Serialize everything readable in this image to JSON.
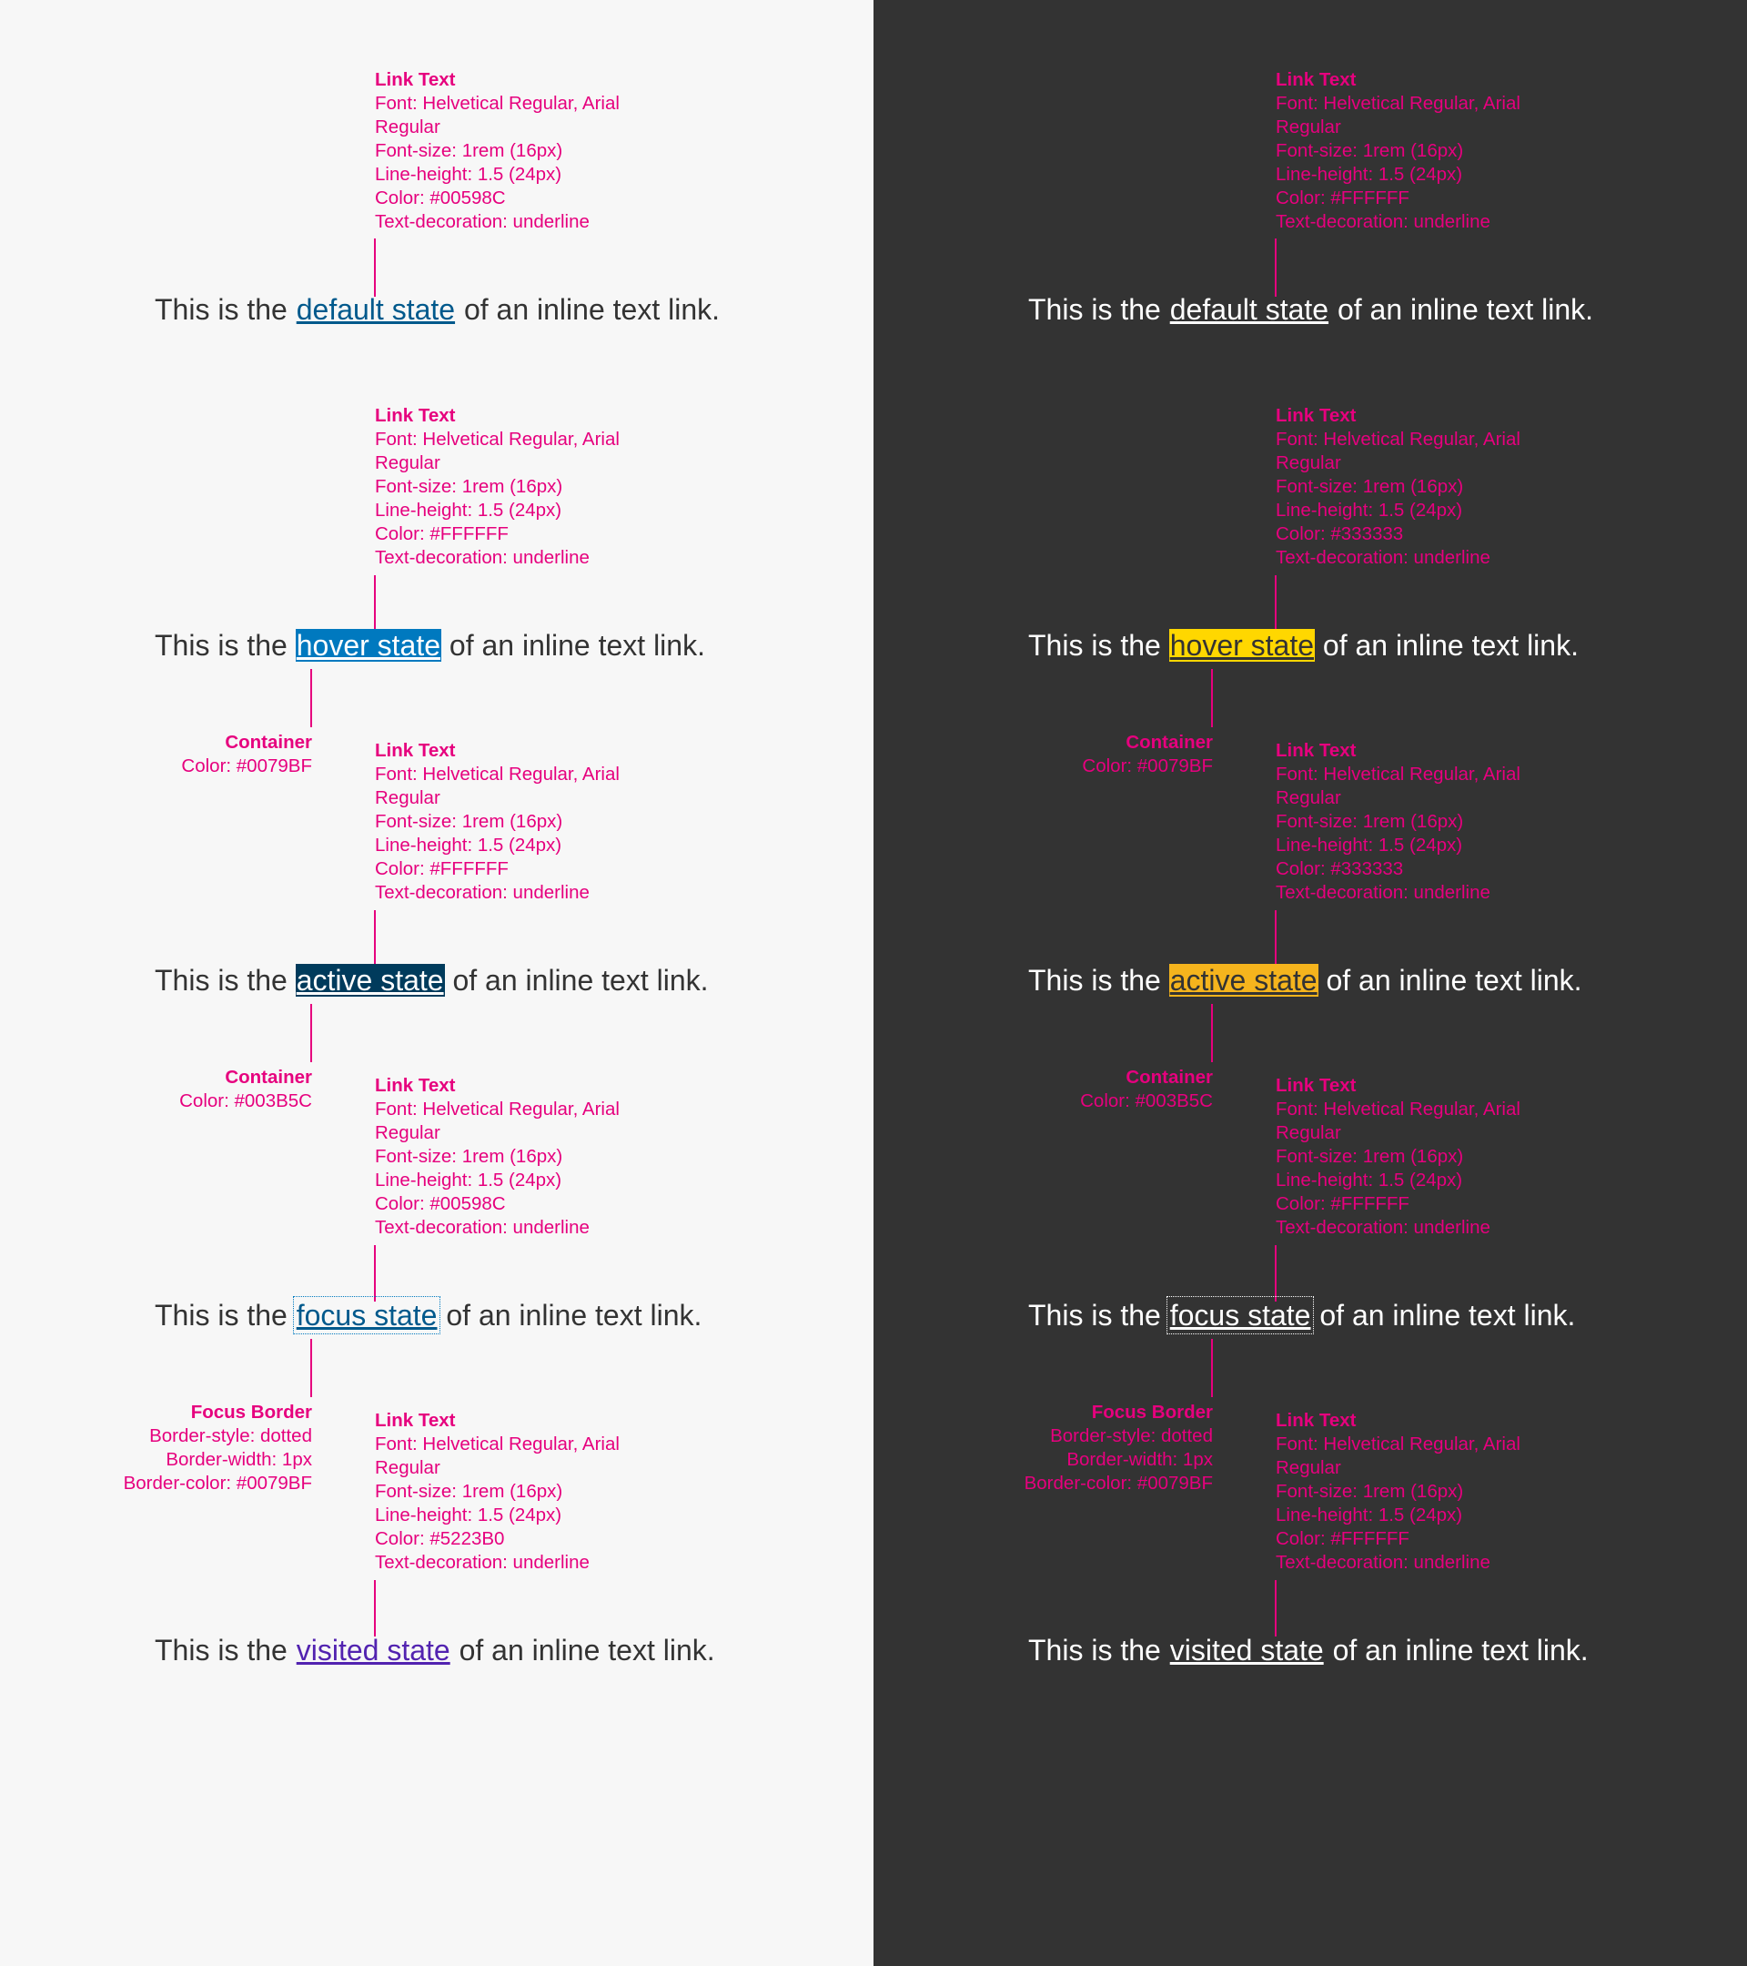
{
  "sentence": {
    "prefix": "This is the",
    "suffix": "of an inline text link."
  },
  "light": {
    "default": {
      "link": "default state",
      "spec": {
        "heading": "Link Text",
        "font": "Font: Helvetical Regular, Arial",
        "font2": "Regular",
        "size": "Font-size: 1rem (16px)",
        "line_height": "Line-height: 1.5 (24px)",
        "color": "Color: #00598C",
        "decoration": "Text-decoration: underline"
      }
    },
    "hover": {
      "link": "hover state",
      "spec": {
        "heading": "Link Text",
        "font": "Font: Helvetical Regular, Arial",
        "font2": "Regular",
        "size": "Font-size: 1rem (16px)",
        "line_height": "Line-height: 1.5 (24px)",
        "color": "Color: #FFFFFF",
        "decoration": "Text-decoration: underline"
      },
      "container": {
        "heading": "Container",
        "color": "Color: #0079BF"
      }
    },
    "active": {
      "link": "active state",
      "spec": {
        "heading": "Link Text",
        "font": "Font: Helvetical Regular, Arial",
        "font2": "Regular",
        "size": "Font-size: 1rem (16px)",
        "line_height": "Line-height: 1.5 (24px)",
        "color": "Color: #FFFFFF",
        "decoration": "Text-decoration: underline"
      },
      "container": {
        "heading": "Container",
        "color": "Color: #003B5C"
      }
    },
    "focus": {
      "link": "focus state",
      "spec": {
        "heading": "Link Text",
        "font": "Font: Helvetical Regular, Arial",
        "font2": "Regular",
        "size": "Font-size: 1rem (16px)",
        "line_height": "Line-height: 1.5 (24px)",
        "color": "Color: #00598C",
        "decoration": "Text-decoration: underline"
      },
      "border": {
        "heading": "Focus Border",
        "style": "Border-style: dotted",
        "width": "Border-width: 1px",
        "color": "Border-color: #0079BF"
      }
    },
    "visited": {
      "link": "visited state",
      "spec": {
        "heading": "Link Text",
        "font": "Font: Helvetical Regular, Arial",
        "font2": "Regular",
        "size": "Font-size: 1rem (16px)",
        "line_height": "Line-height: 1.5 (24px)",
        "color": "Color: #5223B0",
        "decoration": "Text-decoration: underline"
      }
    }
  },
  "dark": {
    "default": {
      "link": "default state",
      "spec": {
        "heading": "Link Text",
        "font": "Font: Helvetical Regular, Arial",
        "font2": "Regular",
        "size": "Font-size: 1rem (16px)",
        "line_height": "Line-height: 1.5 (24px)",
        "color": "Color: #FFFFFF",
        "decoration": "Text-decoration: underline"
      }
    },
    "hover": {
      "link": "hover state",
      "spec": {
        "heading": "Link Text",
        "font": "Font: Helvetical Regular, Arial",
        "font2": "Regular",
        "size": "Font-size: 1rem (16px)",
        "line_height": "Line-height: 1.5 (24px)",
        "color": "Color: #333333",
        "decoration": "Text-decoration: underline"
      },
      "container": {
        "heading": "Container",
        "color": "Color: #0079BF"
      }
    },
    "active": {
      "link": "active state",
      "spec": {
        "heading": "Link Text",
        "font": "Font: Helvetical Regular, Arial",
        "font2": "Regular",
        "size": "Font-size: 1rem (16px)",
        "line_height": "Line-height: 1.5 (24px)",
        "color": "Color: #333333",
        "decoration": "Text-decoration: underline"
      },
      "container": {
        "heading": "Container",
        "color": "Color: #003B5C"
      }
    },
    "focus": {
      "link": "focus state",
      "spec": {
        "heading": "Link Text",
        "font": "Font: Helvetical Regular, Arial",
        "font2": "Regular",
        "size": "Font-size: 1rem (16px)",
        "line_height": "Line-height: 1.5 (24px)",
        "color": "Color: #FFFFFF",
        "decoration": "Text-decoration: underline"
      },
      "border": {
        "heading": "Focus Border",
        "style": "Border-style: dotted",
        "width": "Border-width: 1px",
        "color": "Border-color: #0079BF"
      }
    },
    "visited": {
      "link": "visited state",
      "spec": {
        "heading": "Link Text",
        "font": "Font: Helvetical Regular, Arial",
        "font2": "Regular",
        "size": "Font-size: 1rem (16px)",
        "line_height": "Line-height: 1.5 (24px)",
        "color": "Color: #FFFFFF",
        "decoration": "Text-decoration: underline"
      }
    }
  },
  "colors": {
    "annotation": "#E6007E",
    "light_bg": "#F7F7F7",
    "dark_bg": "#333333",
    "text_dark": "#333333",
    "hover_container_light": "#0079BF",
    "active_container_light": "#003B5C",
    "hover_container_dark": "#FFD700",
    "active_container_dark": "#F5B41D",
    "visited_link": "#5223B0",
    "default_link": "#00598C"
  }
}
